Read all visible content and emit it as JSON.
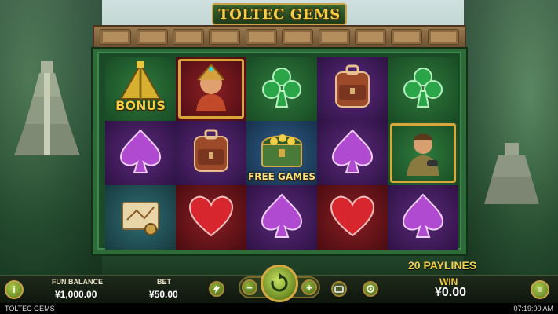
{
  "game": {
    "title": "TOLTEC GEMS",
    "status_title": "TOLTEC GEMS",
    "clock": "07:19:00 AM"
  },
  "reels": [
    [
      {
        "symbol": "bonus-pyramid",
        "label": "BONUS",
        "bg": "green"
      },
      {
        "symbol": "spade",
        "label": "",
        "bg": "purple"
      },
      {
        "symbol": "map-scroll",
        "label": "",
        "bg": "teal"
      }
    ],
    [
      {
        "symbol": "tribal-queen",
        "label": "",
        "bg": "red"
      },
      {
        "symbol": "backpack",
        "label": "",
        "bg": "purple"
      },
      {
        "symbol": "heart",
        "label": "",
        "bg": "red"
      }
    ],
    [
      {
        "symbol": "club",
        "label": "",
        "bg": "green"
      },
      {
        "symbol": "treasure-chest",
        "label": "FREE GAMES",
        "bg": "blue"
      },
      {
        "symbol": "spade",
        "label": "",
        "bg": "purple"
      }
    ],
    [
      {
        "symbol": "backpack",
        "label": "",
        "bg": "purple"
      },
      {
        "symbol": "spade",
        "label": "",
        "bg": "purple"
      },
      {
        "symbol": "heart",
        "label": "",
        "bg": "red"
      }
    ],
    [
      {
        "symbol": "club",
        "label": "",
        "bg": "green"
      },
      {
        "symbol": "explorer",
        "label": "",
        "bg": "green"
      },
      {
        "symbol": "spade",
        "label": "",
        "bg": "purple"
      }
    ]
  ],
  "paylines": "20 PAYLINES",
  "hud": {
    "info_icon": "i",
    "fun_balance_label": "FUN BALANCE",
    "fun_balance_value": "¥1,000.00",
    "bet_label": "BET",
    "bet_value": "¥50.00",
    "minus_label": "−",
    "plus_label": "+",
    "win_label": "WIN",
    "win_value": "¥0.00",
    "menu_icon": "≡"
  },
  "colors": {
    "gold": "#f4cf45",
    "frame_green": "#2f6b3a",
    "button_green": "#8fb03a"
  }
}
